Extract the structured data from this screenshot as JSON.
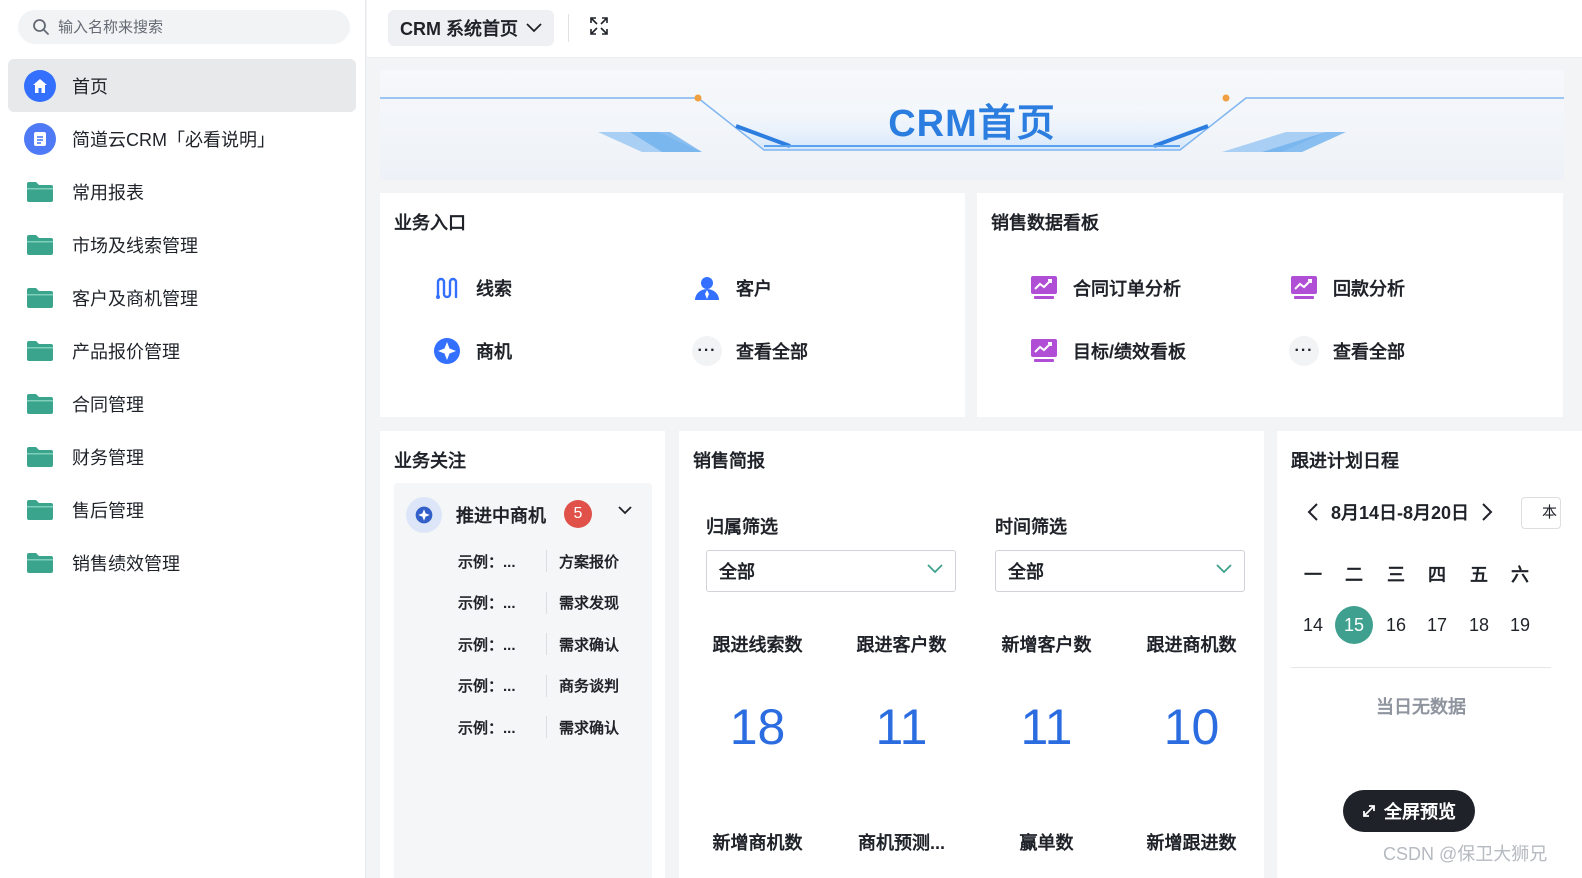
{
  "sidebar": {
    "search_placeholder": "输入名称来搜索",
    "items": [
      {
        "label": "首页"
      },
      {
        "label": "简道云CRM「必看说明」"
      },
      {
        "label": "常用报表"
      },
      {
        "label": "市场及线索管理"
      },
      {
        "label": "客户及商机管理"
      },
      {
        "label": "产品报价管理"
      },
      {
        "label": "合同管理"
      },
      {
        "label": "财务管理"
      },
      {
        "label": "售后管理"
      },
      {
        "label": "销售绩效管理"
      }
    ]
  },
  "topbar": {
    "title": "CRM 系统首页"
  },
  "banner": {
    "title": "CRM首页"
  },
  "biz_entry": {
    "title": "业务入口",
    "items": [
      {
        "label": "线索",
        "icon": "route-icon"
      },
      {
        "label": "客户",
        "icon": "user-icon"
      },
      {
        "label": "商机",
        "icon": "compass-icon"
      },
      {
        "label": "查看全部",
        "icon": "more-icon"
      }
    ]
  },
  "sales_board": {
    "title": "销售数据看板",
    "items": [
      {
        "label": "合同订单分析",
        "icon": "chart-monitor-icon"
      },
      {
        "label": "回款分析",
        "icon": "chart-monitor-icon"
      },
      {
        "label": "目标/绩效看板",
        "icon": "chart-monitor-icon"
      },
      {
        "label": "查看全部",
        "icon": "more-icon"
      }
    ]
  },
  "attention": {
    "title": "业务关注",
    "group_label": "推进中商机",
    "badge_count": "5",
    "rows": [
      {
        "name": "示例：...",
        "stage": "方案报价"
      },
      {
        "name": "示例：...",
        "stage": "需求发现"
      },
      {
        "name": "示例：...",
        "stage": "需求确认"
      },
      {
        "name": "示例：...",
        "stage": "商务谈判"
      },
      {
        "name": "示例：...",
        "stage": "需求确认"
      }
    ]
  },
  "sales_brief": {
    "title": "销售简报",
    "filter_owner_label": "归属筛选",
    "filter_owner_value": "全部",
    "filter_time_label": "时间筛选",
    "filter_time_value": "全部",
    "stats": [
      {
        "label": "跟进线索数",
        "value": "18"
      },
      {
        "label": "跟进客户数",
        "value": "11"
      },
      {
        "label": "新增客户数",
        "value": "11"
      },
      {
        "label": "跟进商机数",
        "value": "10"
      }
    ],
    "stats2": [
      {
        "label": "新增商机数"
      },
      {
        "label": "商机预测..."
      },
      {
        "label": "赢单数"
      },
      {
        "label": "新增跟进数"
      }
    ]
  },
  "schedule": {
    "title": "跟进计划日程",
    "week_range": "8月14日-8月20日",
    "extra_button": "本",
    "weekdays": [
      "一",
      "二",
      "三",
      "四",
      "五",
      "六"
    ],
    "days": [
      "14",
      "15",
      "16",
      "17",
      "18",
      "19"
    ],
    "today": "15",
    "empty_text": "当日无数据"
  },
  "fullscreen_label": "全屏预览",
  "watermark": "CSDN @保卫大狮兄",
  "colors": {
    "accent": "#3370ff",
    "number_blue": "#2b6de0",
    "today_green": "#3fa08f",
    "folder_green": "#3aa58c",
    "badge_red": "#e0514a",
    "chart_purple": "#b04fd6"
  }
}
